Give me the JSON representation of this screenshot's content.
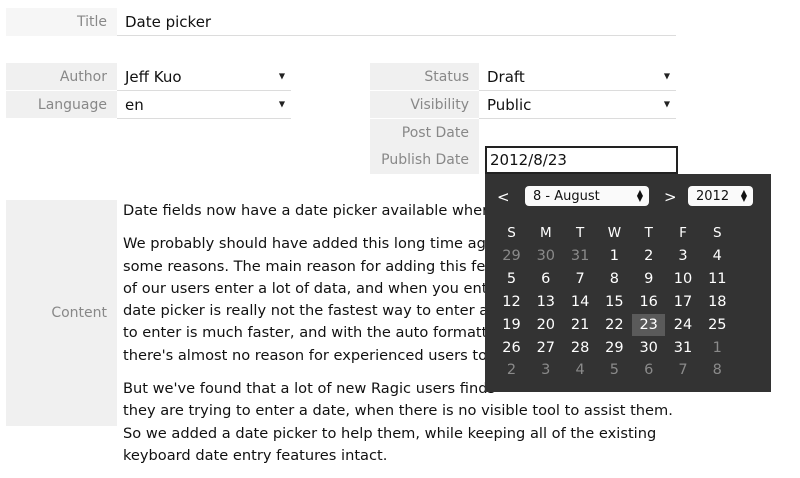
{
  "title": {
    "label": "Title",
    "value": "Date picker"
  },
  "author": {
    "label": "Author",
    "value": "Jeff Kuo"
  },
  "language": {
    "label": "Language",
    "value": "en"
  },
  "status": {
    "label": "Status",
    "value": "Draft"
  },
  "visibility": {
    "label": "Visibility",
    "value": "Public"
  },
  "post_date": {
    "label": "Post Date",
    "value": ""
  },
  "publish_date": {
    "label": "Publish Date",
    "value": "2012/8/23"
  },
  "content": {
    "label": "Content",
    "lines": [
      "Date fields now have a date picker available when",
      "We probably should have added this long time ago",
      "some reasons. The main reason for adding this fea",
      "of our users enter a lot of data, and when you ente",
      "date picker is really not the fastest way to enter a",
      "to enter is much faster, and with the auto formatti",
      "there's almost no reason for experienced users to",
      "But we've found that a lot of new Ragic users finds",
      "they are trying to enter a date, when there is no visible tool to assist them.",
      "So we added a date picker to help them, while keeping all of the existing",
      "keyboard date entry features intact."
    ]
  },
  "calendar": {
    "prev": "<",
    "next": ">",
    "month": "8 - August",
    "year": "2012",
    "weekdays": [
      "S",
      "M",
      "T",
      "W",
      "T",
      "F",
      "S"
    ],
    "weeks": [
      [
        "29",
        "30",
        "31",
        "1",
        "2",
        "3",
        "4"
      ],
      [
        "5",
        "6",
        "7",
        "8",
        "9",
        "10",
        "11"
      ],
      [
        "12",
        "13",
        "14",
        "15",
        "16",
        "17",
        "18"
      ],
      [
        "19",
        "20",
        "21",
        "22",
        "23",
        "24",
        "25"
      ],
      [
        "26",
        "27",
        "28",
        "29",
        "30",
        "31",
        "1"
      ],
      [
        "2",
        "3",
        "4",
        "5",
        "6",
        "7",
        "8"
      ]
    ],
    "selected_day": "23"
  }
}
